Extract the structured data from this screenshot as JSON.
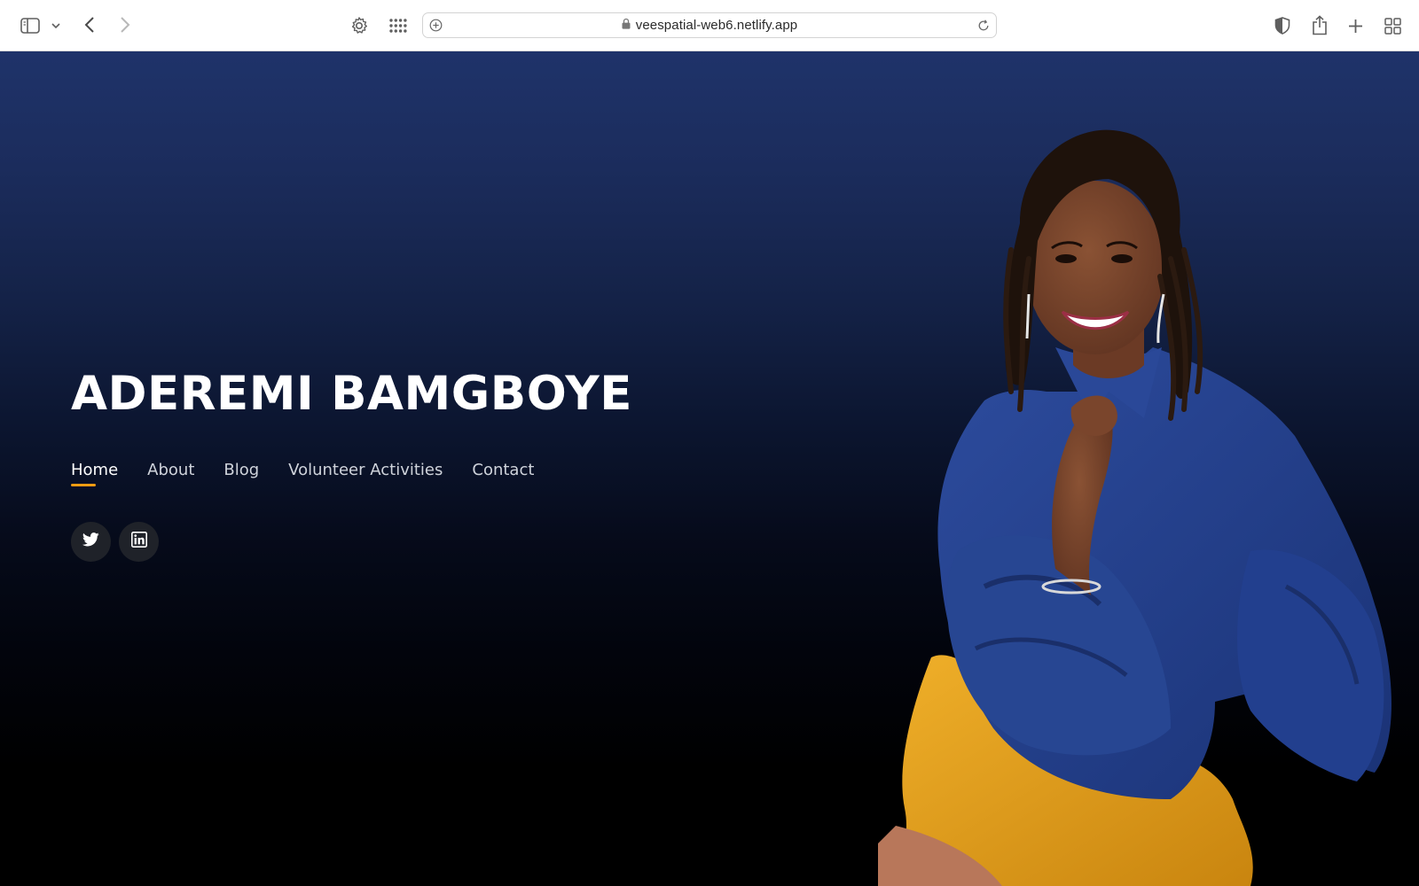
{
  "browser": {
    "url": "veespatial-web6.netlify.app",
    "icons": {
      "sidebar": "sidebar-icon",
      "sidebar_menu": "chevron-down-icon",
      "back": "chevron-left-icon",
      "forward": "chevron-right-icon",
      "settings": "gear-icon",
      "extensions": "grid-dots-icon",
      "site_info": "plus-circle-icon",
      "lock": "lock-icon",
      "reload": "reload-icon",
      "privacy": "shield-icon",
      "share": "share-icon",
      "new_tab": "plus-icon",
      "tab_overview": "tab-grid-icon"
    }
  },
  "hero": {
    "title": "ADEREMI BAMGBOYE"
  },
  "nav": {
    "items": [
      {
        "label": "Home",
        "active": true
      },
      {
        "label": "About",
        "active": false
      },
      {
        "label": "Blog",
        "active": false
      },
      {
        "label": "Volunteer Activities",
        "active": false
      },
      {
        "label": "Contact",
        "active": false
      }
    ]
  },
  "socials": [
    {
      "icon": "twitter-icon"
    },
    {
      "icon": "linkedin-icon"
    }
  ],
  "colors": {
    "background_top": "#1f336a",
    "background_bottom": "#000000",
    "accent": "#f39c12",
    "title": "#ffffff",
    "shirt": "#233f8c",
    "pants": "#e2a01e"
  }
}
